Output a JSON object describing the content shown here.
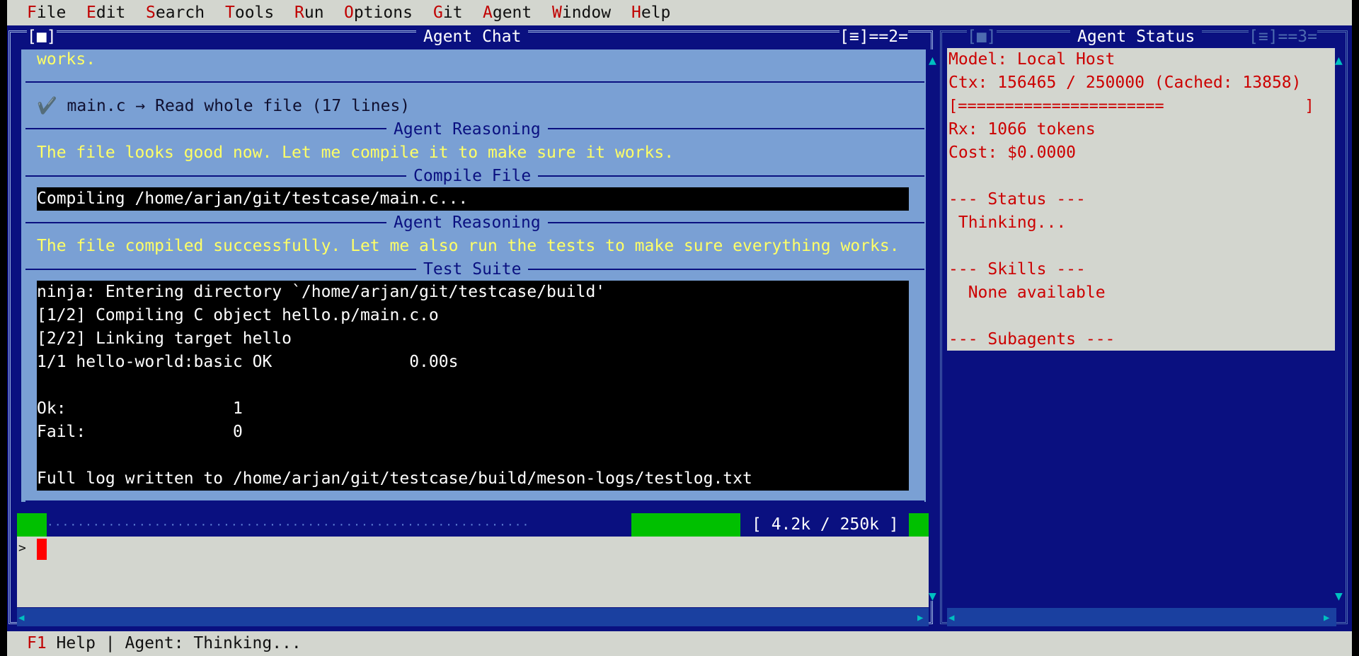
{
  "menu": {
    "items": [
      {
        "hot": "F",
        "rest": "ile"
      },
      {
        "hot": "E",
        "rest": "dit"
      },
      {
        "hot": "S",
        "rest": "earch"
      },
      {
        "hot": "T",
        "rest": "ools"
      },
      {
        "hot": "R",
        "rest": "un"
      },
      {
        "hot": "O",
        "rest": "ptions"
      },
      {
        "hot": "G",
        "rest": "it"
      },
      {
        "hot": "A",
        "rest": "gent"
      },
      {
        "hot": "W",
        "rest": "indow"
      },
      {
        "hot": "H",
        "rest": "elp"
      }
    ]
  },
  "chat_window": {
    "title": "Agent Chat",
    "close_glyph": "[■]",
    "window_controls": "[≡]==2=",
    "top_text": "works.",
    "tool_read": "✔️ main.c → Read whole file (17 lines)",
    "sections": [
      {
        "title": "Agent Reasoning",
        "text": "The file looks good now. Let me compile it to make sure it works."
      },
      {
        "title": "Compile File",
        "text": "Compiling /home/arjan/git/testcase/main.c..."
      },
      {
        "title": "Agent Reasoning",
        "text": "The file compiled successfully. Let me also run the tests to make sure everything works."
      },
      {
        "title": "Test Suite"
      }
    ],
    "test_output": [
      "ninja: Entering directory `/home/arjan/git/testcase/build'",
      "[1/2] Compiling C object hello.p/main.c.o",
      "[2/2] Linking target hello",
      "1/1 hello-world:basic OK              0.00s",
      "",
      "Ok:                 1",
      "Fail:               0",
      "",
      "Full log written to /home/arjan/git/testcase/build/meson-logs/testlog.txt"
    ],
    "status_dots": "·······························································",
    "token_count": "[ 4.2k / 250k ]",
    "prompt": ">"
  },
  "status_window": {
    "title": "Agent Status",
    "close_glyph": "[■]",
    "window_controls": "[≡]==3=",
    "lines": [
      "Model: Local Host",
      "Ctx: 156465 / 250000 (Cached: 13858)",
      "[======================               ]",
      "Rx: 1066 tokens",
      "Cost: $0.0000",
      "",
      "--- Status ---",
      " Thinking...",
      "",
      "--- Skills ---",
      "  None available",
      "",
      "--- Subagents ---"
    ]
  },
  "bottom_bar": {
    "key": "F1",
    "text": " Help | Agent: Thinking..."
  },
  "colors": {
    "desktop": "#0a1080",
    "chat_bg": "#7aa0d4",
    "menu_bg": "#d3d6cf",
    "hotkey": "#c00000",
    "reasoning_text": "#ffff66",
    "status_text": "#cc0000",
    "progress_green": "#00c000"
  }
}
